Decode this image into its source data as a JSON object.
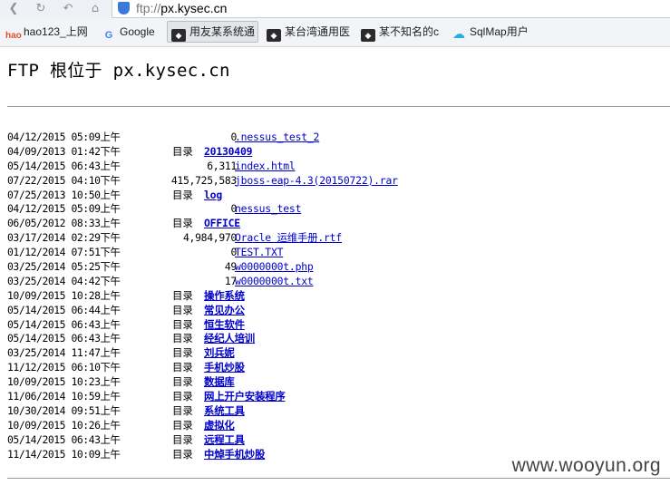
{
  "browser": {
    "address": {
      "protocol": "ftp://",
      "host": "px.kysec.cn"
    },
    "bookmarks": [
      {
        "label": "hao123_上网",
        "icon": "hao123-icon"
      },
      {
        "label": "Google",
        "icon": "google-icon"
      },
      {
        "label": "用友某系统通",
        "icon": "favicon-icon",
        "active": true
      },
      {
        "label": "某台湾通用医",
        "icon": "favicon-icon"
      },
      {
        "label": "某不知名的c",
        "icon": "favicon-icon"
      },
      {
        "label": "SqlMap用户",
        "icon": "cloud-icon"
      }
    ]
  },
  "page": {
    "title": "FTP 根位于 px.kysec.cn",
    "dir_label": "目录",
    "watermark": "www.wooyun.org"
  },
  "listing": [
    {
      "date": "04/12/2015 05:09上午",
      "size": "0",
      "name": ".nessus_test_2",
      "dir": false
    },
    {
      "date": "04/09/2013 01:42下午",
      "size": "",
      "name": "20130409",
      "dir": true
    },
    {
      "date": "05/14/2015 06:43上午",
      "size": "6,311",
      "name": "index.html",
      "dir": false
    },
    {
      "date": "07/22/2015 04:10下午",
      "size": "415,725,583",
      "name": "jboss-eap-4.3(20150722).rar",
      "dir": false
    },
    {
      "date": "07/25/2013 10:50上午",
      "size": "",
      "name": "log",
      "dir": true
    },
    {
      "date": "04/12/2015 05:09上午",
      "size": "0",
      "name": "nessus_test",
      "dir": false
    },
    {
      "date": "06/05/2012 08:33上午",
      "size": "",
      "name": "OFFICE",
      "dir": true
    },
    {
      "date": "03/17/2014 02:29下午",
      "size": "4,984,970",
      "name": "Oracle 运维手册.rtf",
      "dir": false
    },
    {
      "date": "01/12/2014 07:51下午",
      "size": "0",
      "name": "TEST.TXT",
      "dir": false
    },
    {
      "date": "03/25/2014 05:25下午",
      "size": "49",
      "name": "w0000000t.php",
      "dir": false
    },
    {
      "date": "03/25/2014 04:42下午",
      "size": "17",
      "name": "w0000000t.txt",
      "dir": false
    },
    {
      "date": "10/09/2015 10:28上午",
      "size": "",
      "name": "操作系统",
      "dir": true
    },
    {
      "date": "05/14/2015 06:44上午",
      "size": "",
      "name": "常见办公",
      "dir": true
    },
    {
      "date": "05/14/2015 06:43上午",
      "size": "",
      "name": "恒生软件",
      "dir": true
    },
    {
      "date": "05/14/2015 06:43上午",
      "size": "",
      "name": "经纪人培训",
      "dir": true
    },
    {
      "date": "03/25/2014 11:47上午",
      "size": "",
      "name": "刘兵妮",
      "dir": true
    },
    {
      "date": "11/12/2015 06:10下午",
      "size": "",
      "name": "手机炒股",
      "dir": true
    },
    {
      "date": "10/09/2015 10:23上午",
      "size": "",
      "name": "数据库",
      "dir": true
    },
    {
      "date": "11/06/2014 10:59上午",
      "size": "",
      "name": "网上开户安装程序",
      "dir": true
    },
    {
      "date": "10/30/2014 09:51上午",
      "size": "",
      "name": "系统工具",
      "dir": true
    },
    {
      "date": "10/09/2015 10:26上午",
      "size": "",
      "name": "虚拟化",
      "dir": true
    },
    {
      "date": "05/14/2015 06:43上午",
      "size": "",
      "name": "远程工具",
      "dir": true
    },
    {
      "date": "11/14/2015 10:09上午",
      "size": "",
      "name": "中焯手机炒股",
      "dir": true
    }
  ]
}
